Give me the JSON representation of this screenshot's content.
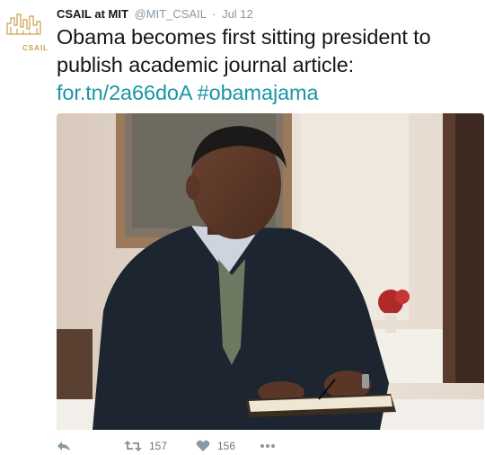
{
  "account": {
    "display_name": "CSAIL at MIT",
    "handle": "@MIT_CSAIL",
    "separator": "·",
    "timestamp": "Jul 12",
    "avatar_text": "CSAIL",
    "avatar_color": "#c9a14a"
  },
  "tweet": {
    "text_line_1": "Obama becomes first sitting president to",
    "text_line_2": "publish academic journal article:",
    "link_url": "for.tn/2a66doA",
    "hashtag": "#obamajama",
    "link_color": "#1b95a5"
  },
  "media": {
    "icon": "photo-of-president-writing"
  },
  "actions": {
    "reply_icon": "reply-icon",
    "retweet_icon": "retweet-icon",
    "retweet_count": "157",
    "like_icon": "heart-icon",
    "like_count": "156",
    "more_icon": "more-icon"
  }
}
